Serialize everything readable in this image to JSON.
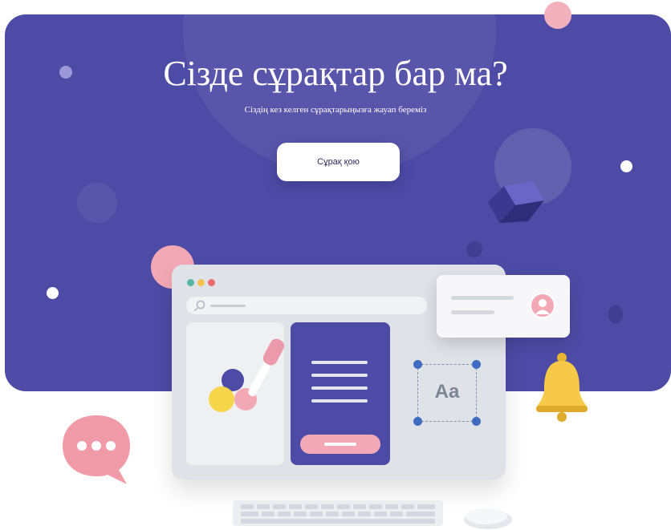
{
  "hero": {
    "title": "Сізде сұрақтар бар ма?",
    "subtitle": "Сіздің кез келген сұрақтарыңызға жауап береміз",
    "button_label": "Сұрақ қою"
  },
  "illustration": {
    "badge_text": "Aa",
    "icons": [
      "chat-bubble-icon",
      "bell-icon",
      "avatar-icon",
      "search-icon",
      "color-dropper-icon",
      "cube-icon",
      "keyboard-icon",
      "mouse-icon"
    ]
  },
  "colors": {
    "hero_background": "#4e4ba6",
    "accent_pink": "#f3a9b5",
    "accent_yellow": "#f2c14e",
    "handle_blue": "#3f6cc1"
  }
}
